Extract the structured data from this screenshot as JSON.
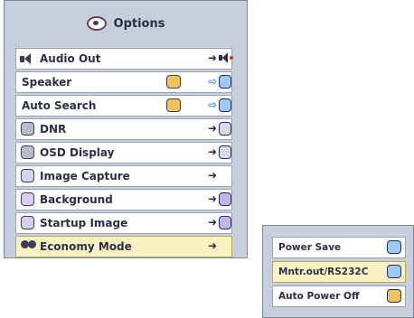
{
  "menu": {
    "title": "Options",
    "items": [
      {
        "label": "Audio Out",
        "arrow": "➜",
        "arrow_style": "solid"
      },
      {
        "label": "Speaker",
        "arrow": "⇨",
        "arrow_style": "hollow"
      },
      {
        "label": "Auto Search",
        "arrow": "⇨",
        "arrow_style": "hollow"
      },
      {
        "label": "DNR",
        "arrow": "➜",
        "arrow_style": "solid"
      },
      {
        "label": "OSD Display",
        "arrow": "➜",
        "arrow_style": "solid"
      },
      {
        "label": "Image Capture",
        "arrow": "➜",
        "arrow_style": "solid"
      },
      {
        "label": "Background",
        "arrow": "➜",
        "arrow_style": "solid"
      },
      {
        "label": "Startup Image",
        "arrow": "➜",
        "arrow_style": "solid"
      },
      {
        "label": "Economy Mode",
        "arrow": "➜",
        "arrow_style": "solid",
        "highlighted": true
      }
    ]
  },
  "submenu": {
    "items": [
      {
        "label": "Power Save"
      },
      {
        "label": "Mntr.out/RS232C",
        "highlighted": true
      },
      {
        "label": "Auto Power Off"
      }
    ]
  },
  "colors": {
    "panel": "#c8cfdc",
    "highlight": "#fbf2c4",
    "text": "#2a2f45",
    "box_blue": "#9fc8f2",
    "box_yellow": "#f4c25a",
    "box_lavender": "#c4b4ea",
    "speaker_dot": "#d23a2a"
  }
}
